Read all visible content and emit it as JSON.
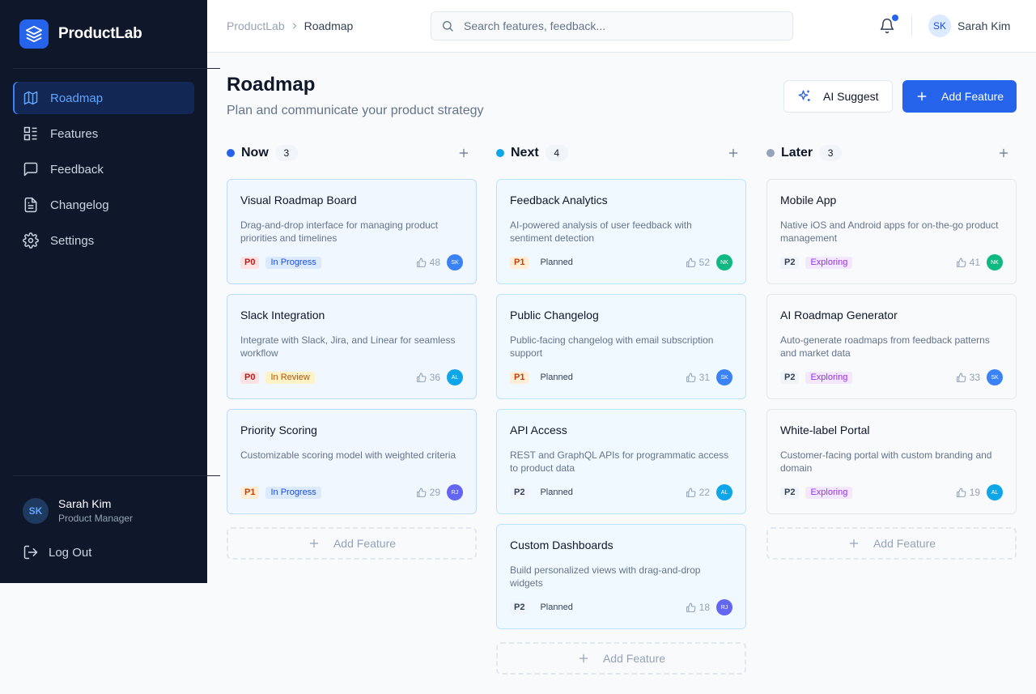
{
  "app": {
    "name": "ProductLab"
  },
  "sidebar": {
    "items": [
      {
        "label": "Roadmap",
        "icon": "map-icon",
        "active": true
      },
      {
        "label": "Features",
        "icon": "list-icon",
        "active": false
      },
      {
        "label": "Feedback",
        "icon": "message-icon",
        "active": false
      },
      {
        "label": "Changelog",
        "icon": "document-icon",
        "active": false
      },
      {
        "label": "Settings",
        "icon": "gear-icon",
        "active": false
      }
    ],
    "user": {
      "initials": "SK",
      "name": "Sarah Kim",
      "role": "Product Manager"
    },
    "logout_label": "Log Out"
  },
  "topbar": {
    "breadcrumb": {
      "root": "ProductLab",
      "current": "Roadmap"
    },
    "search": {
      "placeholder": "Search features, feedback..."
    },
    "user": {
      "initials": "SK",
      "name": "Sarah Kim"
    }
  },
  "header": {
    "title": "Roadmap",
    "subtitle": "Plan and communicate your product strategy",
    "ai_button": "AI Suggest",
    "add_button": "Add Feature"
  },
  "colors": {
    "accent": "#2563eb",
    "now": "#2563eb",
    "next": "#0ea5e9",
    "later": "#94a3b8",
    "avatar_sk": "#3b82f6",
    "avatar_nk": "#10b981",
    "avatar_al": "#0ea5e9",
    "avatar_rj": "#6366f1"
  },
  "columns": [
    {
      "key": "now",
      "name": "Now",
      "count": "3",
      "add_label": "Add Feature",
      "cards": [
        {
          "title": "Visual Roadmap Board",
          "description": "Drag-and-drop interface for managing product priorities and timelines",
          "priority": "P0",
          "status": "In Progress",
          "votes": "48",
          "assignee": "SK"
        },
        {
          "title": "Slack Integration",
          "description": "Integrate with Slack, Jira, and Linear for seamless workflow",
          "priority": "P0",
          "status": "In Review",
          "votes": "36",
          "assignee": "AL"
        },
        {
          "title": "Priority Scoring",
          "description": "Customizable scoring model with weighted criteria",
          "priority": "P1",
          "status": "In Progress",
          "votes": "29",
          "assignee": "RJ"
        }
      ]
    },
    {
      "key": "next",
      "name": "Next",
      "count": "4",
      "add_label": "Add Feature",
      "cards": [
        {
          "title": "Feedback Analytics",
          "description": "AI-powered analysis of user feedback with sentiment detection",
          "priority": "P1",
          "status": "Planned",
          "votes": "52",
          "assignee": "NK"
        },
        {
          "title": "Public Changelog",
          "description": "Public-facing changelog with email subscription support",
          "priority": "P1",
          "status": "Planned",
          "votes": "31",
          "assignee": "SK"
        },
        {
          "title": "API Access",
          "description": "REST and GraphQL APIs for programmatic access to product data",
          "priority": "P2",
          "status": "Planned",
          "votes": "22",
          "assignee": "AL"
        },
        {
          "title": "Custom Dashboards",
          "description": "Build personalized views with drag-and-drop widgets",
          "priority": "P2",
          "status": "Planned",
          "votes": "18",
          "assignee": "RJ"
        }
      ]
    },
    {
      "key": "later",
      "name": "Later",
      "count": "3",
      "add_label": "Add Feature",
      "cards": [
        {
          "title": "Mobile App",
          "description": "Native iOS and Android apps for on-the-go product management",
          "priority": "P2",
          "status": "Exploring",
          "votes": "41",
          "assignee": "NK"
        },
        {
          "title": "AI Roadmap Generator",
          "description": "Auto-generate roadmaps from feedback patterns and market data",
          "priority": "P2",
          "status": "Exploring",
          "votes": "33",
          "assignee": "SK"
        },
        {
          "title": "White-label Portal",
          "description": "Customer-facing portal with custom branding and domain",
          "priority": "P2",
          "status": "Exploring",
          "votes": "19",
          "assignee": "AL"
        }
      ]
    }
  ]
}
